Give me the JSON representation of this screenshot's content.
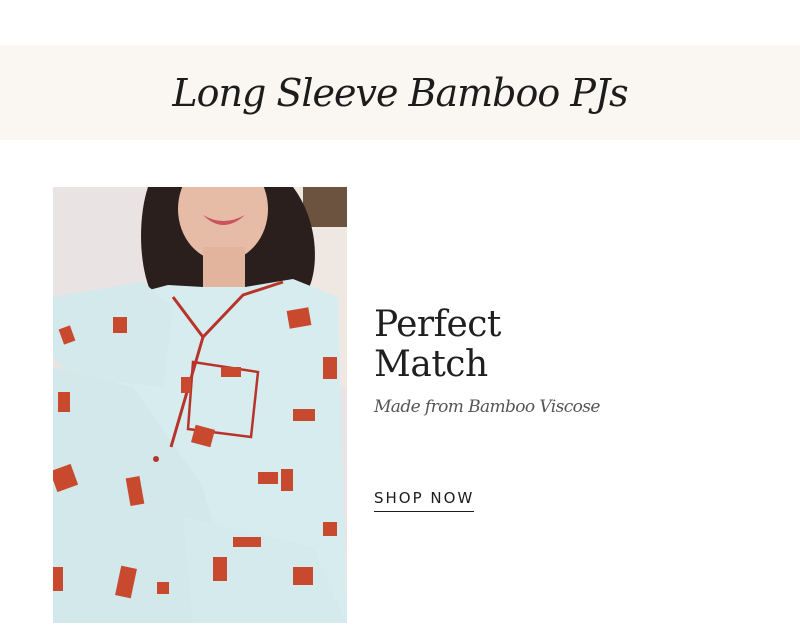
{
  "banner": {
    "title": "Long Sleeve Bamboo PJs"
  },
  "feature": {
    "image_alt": "Woman wearing light blue long sleeve bamboo pajamas with red trim and print",
    "headline_line1": "Perfect",
    "headline_line2": "Match",
    "subhead": "Made from Bamboo Viscose",
    "cta_label": "SHOP NOW"
  },
  "colors": {
    "banner_bg": "#faf6f1",
    "text": "#1c1c1c",
    "pajama_blue": "#d6ebec",
    "trim_red": "#b8342a"
  }
}
